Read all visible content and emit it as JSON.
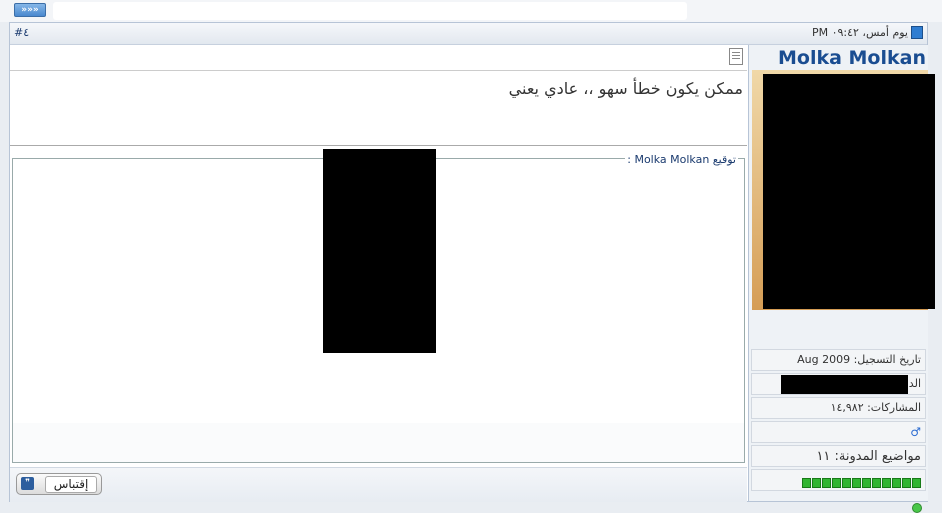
{
  "nav": {
    "arrow_label": "»»»"
  },
  "post": {
    "number": "#٤",
    "date": "يوم أمس، ٠٩:٤٢ PM",
    "message": "ممكن يكون خطأ سهو ،، عادي يعني",
    "signature_legend": "توقيع Molka Molkan :",
    "quote_label": "إقتباس"
  },
  "user": {
    "name": "Molka Molkan",
    "joined": "تاريخ التسجيل: Aug 2009",
    "country_label": "الدو",
    "posts": "المشاركات: ١٤,٩٨٢",
    "gender_icon": "male-icon",
    "blog_posts": "مواضيع المدونة: ١١",
    "reputation_pips": 12
  },
  "colors": {
    "username": "#1a4d91",
    "reputation": "#31b531",
    "online": "#49c749"
  }
}
